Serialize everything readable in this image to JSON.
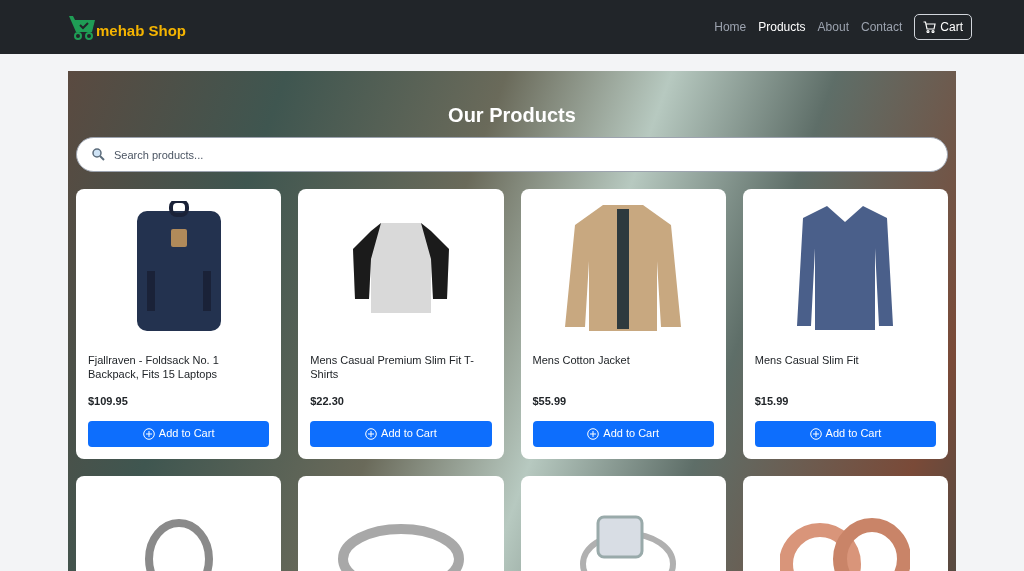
{
  "brand": {
    "name": "mehab Shop"
  },
  "nav": [
    {
      "label": "Home",
      "selected": false
    },
    {
      "label": "Products",
      "selected": true
    },
    {
      "label": "About",
      "selected": false
    },
    {
      "label": "Contact",
      "selected": false
    }
  ],
  "cart_button": {
    "label": "Cart"
  },
  "heading": "Our Products",
  "search": {
    "placeholder": "Search products..."
  },
  "products": [
    {
      "kind": "backpack",
      "title": "Fjallraven - Foldsack No. 1 Backpack, Fits 15 Laptops",
      "price": "$109.95",
      "button": "Add to Cart"
    },
    {
      "kind": "tshirt",
      "title": "Mens Casual Premium Slim Fit T-Shirts",
      "price": "$22.30",
      "button": "Add to Cart"
    },
    {
      "kind": "jacket",
      "title": "Mens Cotton Jacket",
      "price": "$55.99",
      "button": "Add to Cart"
    },
    {
      "kind": "sweater",
      "title": "Mens Casual Slim Fit",
      "price": "$15.99",
      "button": "Add to Cart"
    },
    {
      "kind": "bracelet"
    },
    {
      "kind": "ring"
    },
    {
      "kind": "diamond-ring"
    },
    {
      "kind": "band-rings"
    }
  ]
}
